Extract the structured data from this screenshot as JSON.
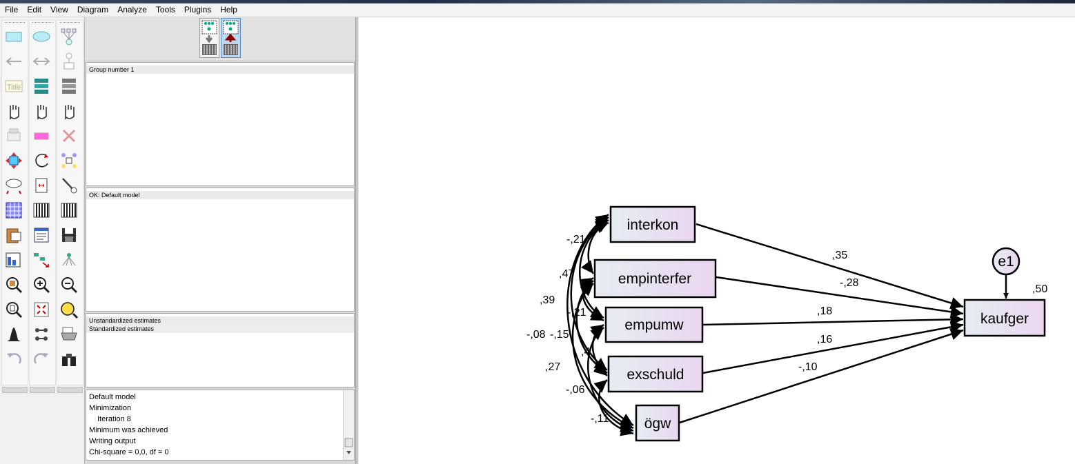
{
  "menu": [
    "File",
    "Edit",
    "View",
    "Diagram",
    "Analyze",
    "Tools",
    "Plugins",
    "Help"
  ],
  "toolbox_icons": [
    [
      "rectangle-icon",
      "ellipse-icon",
      "latent-indicator-icon"
    ],
    [
      "single-arrow-icon",
      "double-arrow-icon",
      "unique-variable-icon"
    ],
    [
      "title-icon",
      "variables-in-model-icon",
      "variables-in-dataset-icon"
    ],
    [
      "select-one-icon",
      "select-all-icon",
      "deselect-all-icon"
    ],
    [
      "duplicate-icon",
      "move-icon",
      "erase-icon"
    ],
    [
      "move-parameter-icon",
      "rotate-icon",
      "reflect-icon"
    ],
    [
      "shape-change-icon",
      "scroll-icon",
      "touch-up-icon"
    ],
    [
      "data-files-icon",
      "analysis-properties-icon",
      "calculate-estimates-icon"
    ],
    [
      "copy-to-clipboard-icon",
      "view-text-icon",
      "save-icon"
    ],
    [
      "object-properties-icon",
      "drag-properties-icon",
      "preserve-symmetries-icon"
    ],
    [
      "zoom-in-area-icon",
      "zoom-in-icon",
      "zoom-out-icon"
    ],
    [
      "page-view-icon",
      "fit-to-page-icon",
      "loupe-icon"
    ],
    [
      "bayesian-icon",
      "multiple-group-icon",
      "print-icon"
    ],
    [
      "undo-icon",
      "redo-icon",
      "specification-search-icon"
    ]
  ],
  "title_tool_text": "Title",
  "panes": {
    "groups_label": "Group number 1",
    "models_label": "OK: Default model",
    "estimates_unstd": "Unstandardized estimates",
    "estimates_std": "Standardized estimates"
  },
  "log_lines": [
    "Default model",
    "Minimization",
    "Iteration 8",
    "Minimum was achieved",
    "Writing output",
    "Chi-square = 0,0, df = 0"
  ],
  "diagram": {
    "nodes": {
      "interkon": "interkon",
      "empinterfer": "empinterfer",
      "empumw": "empumw",
      "exschuld": "exschuld",
      "ogw": "ögw",
      "kaufger": "kaufger",
      "e1": "e1"
    },
    "regression_weights": {
      "interkon": ",35",
      "empinterfer": "-,28",
      "empumw": ",18",
      "exschuld": ",16",
      "ogw": "-,10"
    },
    "r_squared": ",50",
    "correlations": {
      "interkon_empinterfer": "-,21",
      "interkon_empumw": ",47",
      "interkon_exschuld": ",39",
      "interkon_ogw": "-,08",
      "empinterfer_empumw": "-,21",
      "empinterfer_exschuld": "-,15",
      "empinterfer_ogw": ",27",
      "empumw_exschuld": ",4",
      "empumw_ogw": "-,06",
      "exschuld_ogw": "-,11"
    }
  },
  "colors": {
    "node_gradient_start": "#e6ecf2",
    "node_gradient_end": "#ead6ef",
    "canvas": "#ffffff",
    "panel": "#d8d8d8"
  }
}
